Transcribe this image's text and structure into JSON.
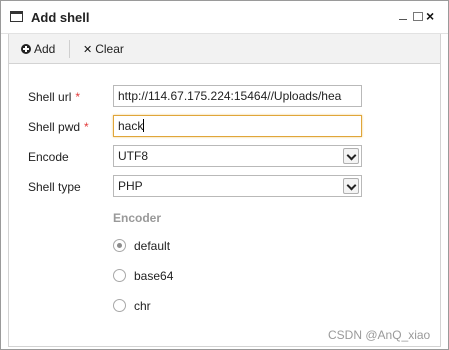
{
  "window": {
    "title": "Add shell",
    "controls": {
      "minimize": "minimize-icon",
      "maximize": "maximize-icon",
      "close": "×"
    }
  },
  "toolbar": {
    "add_label": "Add",
    "clear_label": "Clear",
    "add_icon": "plus-circle-icon",
    "clear_icon": "close-icon"
  },
  "form": {
    "shell_url": {
      "label": "Shell url",
      "required_mark": "*",
      "value": "http://114.67.175.224:15464//Uploads/hea"
    },
    "shell_pwd": {
      "label": "Shell pwd",
      "required_mark": "*",
      "value": "hack"
    },
    "encode": {
      "label": "Encode",
      "value": "UTF8"
    },
    "shell_type": {
      "label": "Shell type",
      "value": "PHP"
    }
  },
  "encoder": {
    "title": "Encoder",
    "options": [
      {
        "label": "default",
        "checked": true
      },
      {
        "label": "base64",
        "checked": false
      },
      {
        "label": "chr",
        "checked": false
      }
    ]
  },
  "watermark": "CSDN @AnQ_xiao",
  "colors": {
    "required": "#e23a3a",
    "focus_border": "#e0a63a",
    "toolbar_bg": "#f2f2f2"
  }
}
